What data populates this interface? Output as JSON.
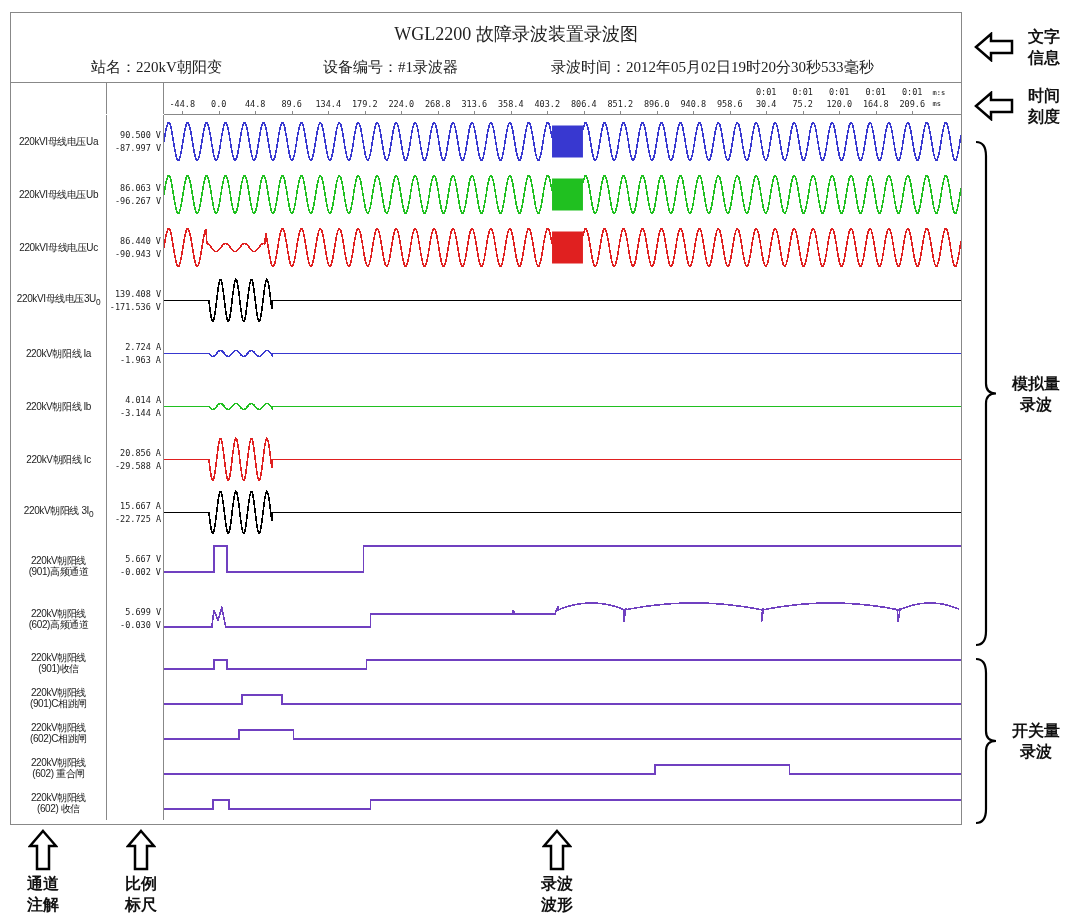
{
  "header": {
    "title": "WGL2200 故障录波装置录波图",
    "station": "站名：220kV朝阳变",
    "device": "设备编号：#1录波器",
    "time": "录波时间：2012年05月02日19时20分30秒533毫秒"
  },
  "time_axis": {
    "ticks": [
      {
        "label": "-44.8"
      },
      {
        "label": "0.0"
      },
      {
        "label": "44.8"
      },
      {
        "label": "89.6"
      },
      {
        "label": "134.4"
      },
      {
        "label": "179.2"
      },
      {
        "label": "224.0"
      },
      {
        "label": "268.8"
      },
      {
        "label": "313.6"
      },
      {
        "label": "358.4"
      },
      {
        "label": "403.2"
      },
      {
        "label": "806.4"
      },
      {
        "label": "851.2"
      },
      {
        "label": "896.0"
      },
      {
        "label": "940.8"
      },
      {
        "label": "958.6"
      },
      {
        "top": "0:01",
        "label": "30.4"
      },
      {
        "top": "0:01",
        "label": "75.2"
      },
      {
        "top": "0:01",
        "label": "120.0"
      },
      {
        "top": "0:01",
        "label": "164.8"
      },
      {
        "top": "0:01",
        "label": "209.6"
      }
    ],
    "unit_top": "m:s",
    "unit_bottom": "ms"
  },
  "channels": [
    {
      "name": "220kVI母线电压Ua",
      "max": "90.500 V",
      "min": "-87.997 V",
      "kind": "sine",
      "color": "#3838d0"
    },
    {
      "name": "220kVI母线电压Ub",
      "max": "86.063 V",
      "min": "-96.267 V",
      "kind": "sine",
      "color": "#20c020"
    },
    {
      "name": "220kVI母线电压Uc",
      "max": "86.440 V",
      "min": "-90.943 V",
      "kind": "sine-sag",
      "color": "#e02020"
    },
    {
      "name": "220kVI母线电压3U$_{0}$",
      "max": "139.408 V",
      "min": "-171.536 V",
      "kind": "burst-large",
      "color": "#000000"
    },
    {
      "name": "220kV朝阳线  Ia",
      "max": "2.724 A",
      "min": "-1.963 A",
      "kind": "burst-small",
      "color": "#3838d0"
    },
    {
      "name": "220kV朝阳线  Ib",
      "max": "4.014 A",
      "min": "-3.144 A",
      "kind": "burst-small",
      "color": "#20c020"
    },
    {
      "name": "220kV朝阳线  Ic",
      "max": "20.856 A",
      "min": "-29.588 A",
      "kind": "burst-large",
      "color": "#e02020"
    },
    {
      "name": "220kV朝阳线 3I$_{0}$",
      "max": "15.667 A",
      "min": "-22.725 A",
      "kind": "burst-large",
      "color": "#000000"
    },
    {
      "name": "220kV朝阳线\n(901)高频通道",
      "max": "5.667 V",
      "min": "-0.002 V",
      "kind": "hf-step",
      "color": "#7040c0"
    },
    {
      "name": "220kV朝阳线\n(602)高频通道",
      "max": "5.699 V",
      "min": "-0.030 V",
      "kind": "hf-arc",
      "color": "#7040c0"
    },
    {
      "name": "220kV朝阳线\n(901)收信",
      "kind": "switch",
      "color": "#7040c0"
    },
    {
      "name": "220kV朝阳线\n(901)C相跳闸",
      "kind": "switch",
      "color": "#7040c0"
    },
    {
      "name": "220kV朝阳线\n(602)C相跳闸",
      "kind": "switch",
      "color": "#7040c0"
    },
    {
      "name": "220kV朝阳线\n(602) 重合闸",
      "kind": "switch",
      "color": "#7040c0"
    },
    {
      "name": "220kV朝阳线\n(602) 收信",
      "kind": "switch",
      "color": "#7040c0"
    }
  ],
  "annotations": {
    "side": [
      {
        "kind": "arrow",
        "text": "文字信息"
      },
      {
        "kind": "arrow",
        "text": "时间刻度"
      },
      {
        "kind": "brace",
        "text": "模拟量录波"
      },
      {
        "kind": "brace",
        "text": "开关量录波"
      }
    ],
    "bottom": [
      {
        "text": "通道注解"
      },
      {
        "text": "比例标尺"
      },
      {
        "text": "录波波形"
      }
    ]
  }
}
